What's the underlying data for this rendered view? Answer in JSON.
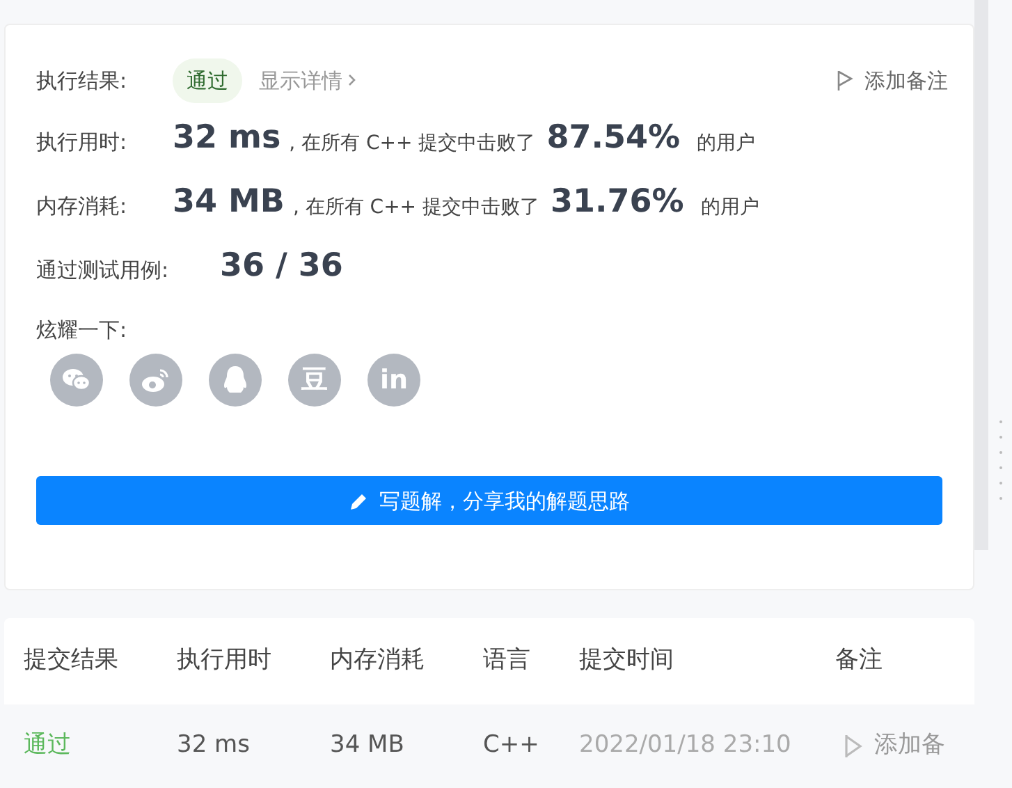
{
  "result": {
    "label": "执行结果:",
    "status": "通过",
    "details_link": "显示详情",
    "add_note": "添加备注"
  },
  "stats": [
    {
      "label": "执行用时:",
      "value": "32 ms",
      "middle": ", 在所有 C++ 提交中击败了",
      "percent": "87.54%",
      "tail": "的用户"
    },
    {
      "label": "内存消耗:",
      "value": "34 MB",
      "middle": ", 在所有 C++ 提交中击败了",
      "percent": "31.76%",
      "tail": "的用户"
    }
  ],
  "tests": {
    "label": "通过测试用例:",
    "value": "36 / 36"
  },
  "share": {
    "label": "炫耀一下:",
    "buttons": [
      {
        "kind": "wechat"
      },
      {
        "kind": "weibo"
      },
      {
        "kind": "qq"
      },
      {
        "kind": "douban",
        "glyph": "豆"
      },
      {
        "kind": "linkedin",
        "glyph": "in"
      }
    ]
  },
  "write_button": "写题解，分享我的解题思路",
  "table": {
    "columns": [
      "提交结果",
      "执行用时",
      "内存消耗",
      "语言",
      "提交时间",
      "备注"
    ],
    "rows": [
      {
        "status": "通过",
        "time": "32 ms",
        "memory": "34 MB",
        "language": "C++",
        "submitted": "2022/01/18 23:10",
        "note": "添加备"
      }
    ]
  }
}
